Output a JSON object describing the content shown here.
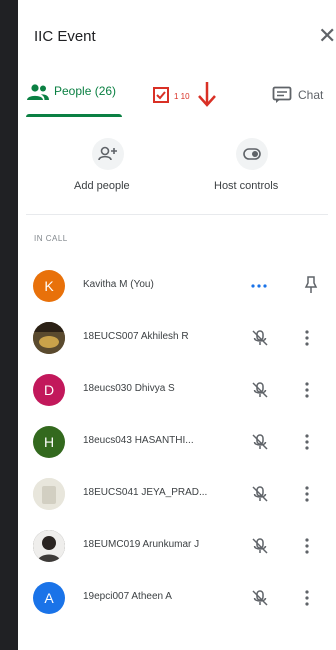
{
  "meeting": {
    "title": "IIC Event"
  },
  "tabs": {
    "people_label": "People (26)",
    "mid_small": "1 10",
    "chat_label": "Chat"
  },
  "actions": {
    "add_people": "Add people",
    "host_controls": "Host controls"
  },
  "section": {
    "label": "IN CALL"
  },
  "participants": [
    {
      "name": "Kavitha M  (You)",
      "avatar": "K",
      "avatar_color": "#e8710a"
    },
    {
      "name": "18EUCS007 Akhilesh R",
      "avatar": "",
      "avatar_color": "#5a4a2e"
    },
    {
      "name": "18eucs030 Dhivya S",
      "avatar": "D",
      "avatar_color": "#c2185b"
    },
    {
      "name": "18eucs043 HASANTHI...",
      "avatar": "H",
      "avatar_color": "#33691e"
    },
    {
      "name": "18EUCS041 JEYA_PRAD...",
      "avatar": "",
      "avatar_color": "#e8e6dc"
    },
    {
      "name": "18EUMC019 Arunkumar J",
      "avatar": "",
      "avatar_color": "#3d3a38"
    },
    {
      "name": "19epci007 Atheen A",
      "avatar": "A",
      "avatar_color": "#1a73e8"
    }
  ],
  "colors": {
    "accent": "#0b8043",
    "annotation_red": "#d93025"
  },
  "icons": {
    "close": "close-icon",
    "people": "people-icon",
    "chat": "chat-icon",
    "mic_muted": "mic-off-icon",
    "more": "more-vert-icon",
    "pin": "pin-icon"
  }
}
